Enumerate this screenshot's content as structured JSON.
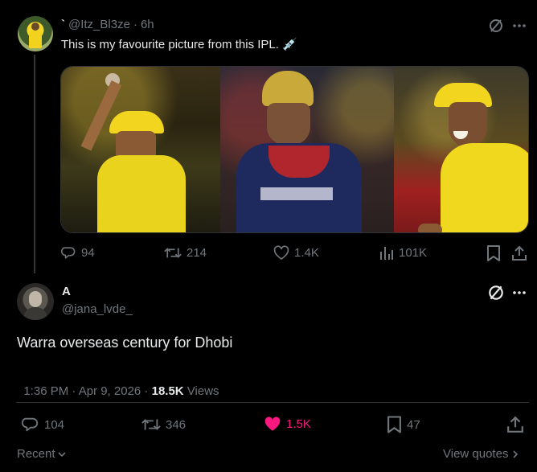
{
  "reply": {
    "author_display": "`",
    "handle": "@Itz_Bl3ze",
    "separator": "·",
    "time": "6h",
    "text": "This is my favourite picture from this IPL. 💉",
    "actions": {
      "replies": "94",
      "reposts": "214",
      "likes": "1.4K",
      "views": "101K"
    }
  },
  "main": {
    "name": "A",
    "handle": "@jana_lvde_",
    "text": "Warra overseas century for Dhobi",
    "timestamp": "1:36 PM · Apr 9, 2026 · ",
    "views_count": "18.5K",
    "views_label": " Views",
    "actions": {
      "replies": "104",
      "reposts": "346",
      "likes": "1.5K",
      "bookmarks": "47"
    }
  },
  "footer": {
    "sort_label": "Recent",
    "view_quotes": "View quotes"
  },
  "colors": {
    "background": "#000000",
    "text": "#e7e9ea",
    "muted": "#71767b",
    "like_active": "#f91880",
    "divider": "#2f3336"
  },
  "icons": [
    "grok-icon",
    "more-icon",
    "reply-icon",
    "repost-icon",
    "like-icon",
    "views-icon",
    "bookmark-icon",
    "share-icon",
    "chevron-down-icon",
    "chevron-right-icon"
  ]
}
